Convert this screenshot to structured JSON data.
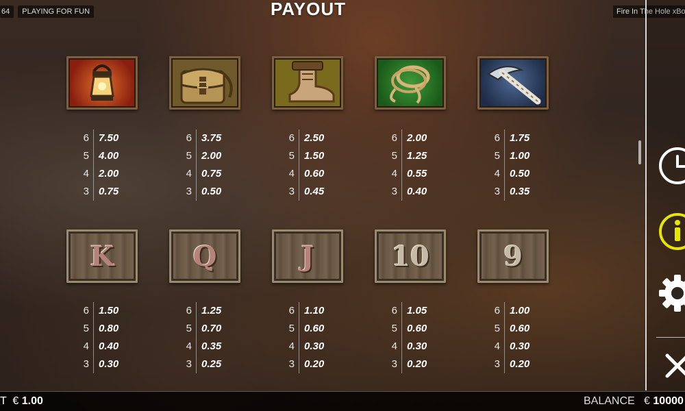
{
  "header": {
    "left_chip_fragment": "64",
    "mode_label": "PLAYING FOR FUN",
    "title": "PAYOUT",
    "game_name": "Fire In The Hole xBo"
  },
  "symbols_row1": [
    {
      "name": "lantern",
      "pays": [
        [
          "6",
          "7.50"
        ],
        [
          "5",
          "4.00"
        ],
        [
          "4",
          "2.00"
        ],
        [
          "3",
          "0.75"
        ]
      ]
    },
    {
      "name": "satchel",
      "pays": [
        [
          "6",
          "3.75"
        ],
        [
          "5",
          "2.00"
        ],
        [
          "4",
          "0.75"
        ],
        [
          "3",
          "0.50"
        ]
      ]
    },
    {
      "name": "boot",
      "pays": [
        [
          "6",
          "2.50"
        ],
        [
          "5",
          "1.50"
        ],
        [
          "4",
          "0.60"
        ],
        [
          "3",
          "0.45"
        ]
      ]
    },
    {
      "name": "rope",
      "pays": [
        [
          "6",
          "2.00"
        ],
        [
          "5",
          "1.25"
        ],
        [
          "4",
          "0.55"
        ],
        [
          "3",
          "0.40"
        ]
      ]
    },
    {
      "name": "pickaxe",
      "pays": [
        [
          "6",
          "1.75"
        ],
        [
          "5",
          "1.00"
        ],
        [
          "4",
          "0.50"
        ],
        [
          "3",
          "0.35"
        ]
      ]
    }
  ],
  "symbols_row2": [
    {
      "letter": "K",
      "pays": [
        [
          "6",
          "1.50"
        ],
        [
          "5",
          "0.80"
        ],
        [
          "4",
          "0.40"
        ],
        [
          "3",
          "0.30"
        ]
      ]
    },
    {
      "letter": "Q",
      "pays": [
        [
          "6",
          "1.25"
        ],
        [
          "5",
          "0.70"
        ],
        [
          "4",
          "0.35"
        ],
        [
          "3",
          "0.25"
        ]
      ]
    },
    {
      "letter": "J",
      "pays": [
        [
          "6",
          "1.10"
        ],
        [
          "5",
          "0.60"
        ],
        [
          "4",
          "0.30"
        ],
        [
          "3",
          "0.20"
        ]
      ]
    },
    {
      "letter": "10",
      "pays": [
        [
          "6",
          "1.05"
        ],
        [
          "5",
          "0.60"
        ],
        [
          "4",
          "0.30"
        ],
        [
          "3",
          "0.20"
        ]
      ]
    },
    {
      "letter": "9",
      "pays": [
        [
          "6",
          "1.00"
        ],
        [
          "5",
          "0.60"
        ],
        [
          "4",
          "0.30"
        ],
        [
          "3",
          "0.20"
        ]
      ]
    }
  ],
  "side_panel": {
    "icons": [
      "history-clock-icon",
      "info-icon",
      "settings-gear-icon",
      "close-icon"
    ],
    "info_color": "#e6e600"
  },
  "footer": {
    "bet_label_fragment": "T",
    "bet_currency": "€",
    "bet_amount": "1.00",
    "balance_label": "BALANCE",
    "balance_currency": "€",
    "balance_amount": "10000"
  }
}
